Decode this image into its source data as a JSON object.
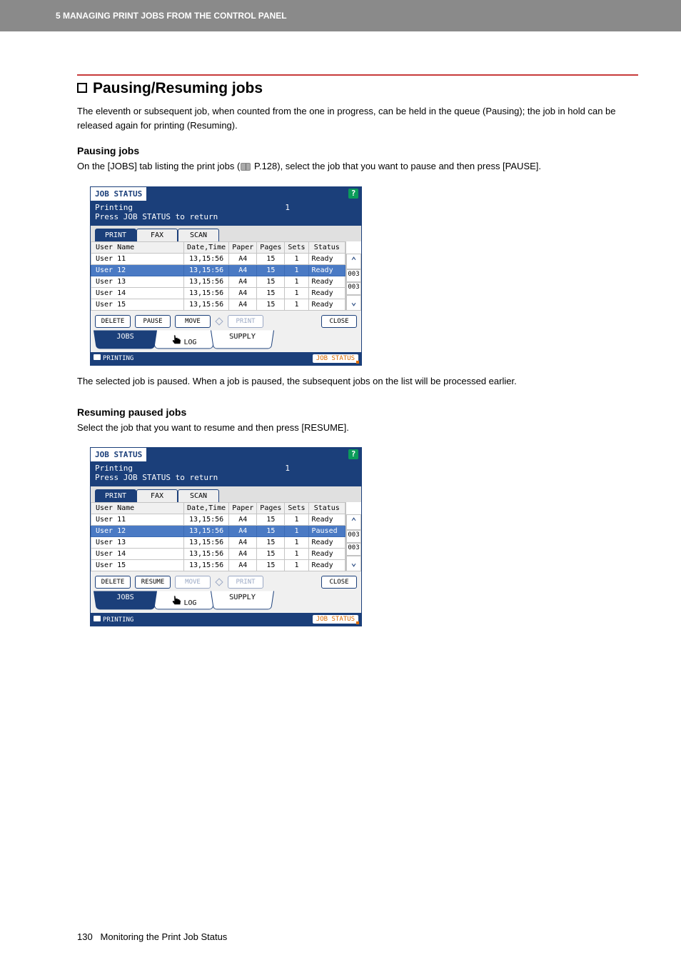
{
  "header": {
    "breadcrumb": "5 MANAGING PRINT JOBS FROM THE CONTROL PANEL"
  },
  "main_title": "Pausing/Resuming jobs",
  "intro_para": "The eleventh or subsequent job, when counted from the one in progress, can be held in the queue (Pausing); the job in hold can be released again for printing (Resuming).",
  "pausing": {
    "title": "Pausing jobs",
    "text_a": "On the [JOBS] tab listing the print jobs (",
    "text_ref": " P.128), select the job that you want to pause and then press [PAUSE].",
    "after_para": "The selected job is paused. When a job is paused, the subsequent jobs on the list will be processed earlier."
  },
  "resuming": {
    "title": "Resuming paused jobs",
    "text": "Select the job that you want to resume and then press [RESUME]."
  },
  "panel_common": {
    "title": "JOB STATUS",
    "status_line1": "Printing",
    "status_line2": "Press JOB STATUS to return",
    "count": "1",
    "tabs": [
      "PRINT",
      "FAX",
      "SCAN"
    ],
    "headers": [
      "User Name",
      "Date,Time",
      "Paper",
      "Pages",
      "Sets",
      "Status"
    ],
    "scroll_page": "003",
    "btn_delete": "DELETE",
    "btn_move": "MOVE",
    "btn_print": "PRINT",
    "btn_close": "CLOSE",
    "tab2_jobs": "JOBS",
    "tab2_log": "LOG",
    "tab2_supply": "SUPPLY",
    "foot_left": "PRINTING",
    "foot_right": "JOB STATUS"
  },
  "panel1": {
    "btn_action": "PAUSE",
    "rows": [
      {
        "u": "User 11",
        "dt": "13,15:56",
        "p": "A4",
        "pg": "15",
        "s": "1",
        "st": "Ready",
        "cls": "top-row"
      },
      {
        "u": "User 12",
        "dt": "13,15:56",
        "p": "A4",
        "pg": "15",
        "s": "1",
        "st": "Ready",
        "cls": "selected"
      },
      {
        "u": "User 13",
        "dt": "13,15:56",
        "p": "A4",
        "pg": "15",
        "s": "1",
        "st": "Ready",
        "cls": ""
      },
      {
        "u": "User 14",
        "dt": "13,15:56",
        "p": "A4",
        "pg": "15",
        "s": "1",
        "st": "Ready",
        "cls": ""
      },
      {
        "u": "User 15",
        "dt": "13,15:56",
        "p": "A4",
        "pg": "15",
        "s": "1",
        "st": "Ready",
        "cls": ""
      }
    ]
  },
  "panel2": {
    "btn_action": "RESUME",
    "rows": [
      {
        "u": "User 11",
        "dt": "13,15:56",
        "p": "A4",
        "pg": "15",
        "s": "1",
        "st": "Ready",
        "cls": "top-row"
      },
      {
        "u": "User 12",
        "dt": "13,15:56",
        "p": "A4",
        "pg": "15",
        "s": "1",
        "st": "Paused",
        "cls": "selected"
      },
      {
        "u": "User 13",
        "dt": "13,15:56",
        "p": "A4",
        "pg": "15",
        "s": "1",
        "st": "Ready",
        "cls": ""
      },
      {
        "u": "User 14",
        "dt": "13,15:56",
        "p": "A4",
        "pg": "15",
        "s": "1",
        "st": "Ready",
        "cls": ""
      },
      {
        "u": "User 15",
        "dt": "13,15:56",
        "p": "A4",
        "pg": "15",
        "s": "1",
        "st": "Ready",
        "cls": ""
      }
    ]
  },
  "footer": {
    "page": "130",
    "text": "Monitoring the Print Job Status"
  }
}
